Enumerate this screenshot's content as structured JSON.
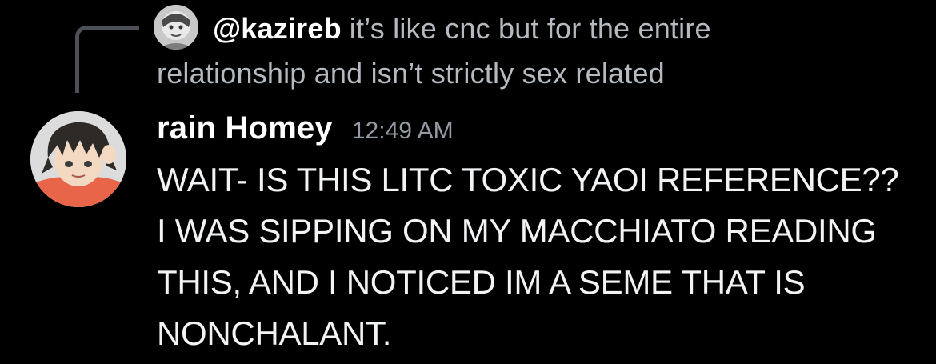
{
  "reply": {
    "username": "@kazireb",
    "text": "it’s like cnc but for the entire relationship and isn’t strictly sex related"
  },
  "message": {
    "author": "rain Homey",
    "timestamp": "12:49 AM",
    "content": "WAIT- IS THIS LITC TOXIC YAOI REFERENCE??\nI WAS SIPPING ON MY MACCHIATO READING\nTHIS, AND I NOTICED IM A SEME THAT IS\nNONCHALANT."
  },
  "colors": {
    "background": "#000000",
    "username": "#ffffff",
    "reply_text": "#b5bac1",
    "timestamp": "#949ba4",
    "message_text": "#f2f3f5",
    "reply_spine": "#4e5058"
  },
  "icons": {
    "reply_spine": "reply-connector-icon"
  }
}
